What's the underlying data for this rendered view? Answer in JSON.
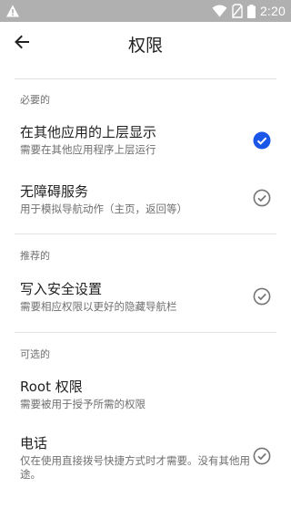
{
  "status_bar": {
    "time": "2:20",
    "icons": [
      "warning-icon",
      "wifi-icon",
      "no-sim-icon",
      "battery-icon"
    ]
  },
  "header": {
    "title": "权限",
    "back_icon": "arrow-left-icon"
  },
  "sections": {
    "required": "必要的",
    "recommended": "推荐的",
    "optional": "可选的"
  },
  "permissions": {
    "overlay": {
      "title": "在其他应用的上层显示",
      "subtitle": "需要在其他应用程序上层运行",
      "granted": true
    },
    "accessibility": {
      "title": "无障碍服务",
      "subtitle": "用于模拟导航动作（主页，返回等）",
      "granted": false
    },
    "secure_settings": {
      "title": "写入安全设置",
      "subtitle": "需要相应权限以更好的隐藏导航栏",
      "granted": false
    },
    "root": {
      "title": "Root 权限",
      "subtitle": "需要被用于授予所需的权限"
    },
    "phone": {
      "title": "电话",
      "subtitle": "仅在使用直接拨号快捷方式时才需要。没有其他用途。",
      "granted": false
    }
  },
  "colors": {
    "accent": "#1a56e8",
    "status_bar": "#b0b0b0",
    "check_outline": "#757575"
  }
}
